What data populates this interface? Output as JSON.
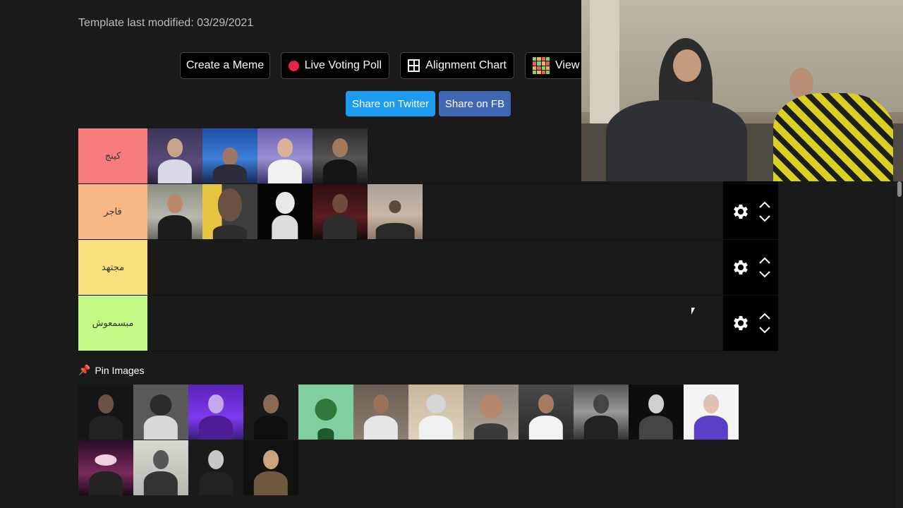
{
  "template_modified": "Template last modified: 03/29/2021",
  "toolbar": {
    "create_meme": "Create a Meme",
    "live_voting": "Live Voting Poll",
    "alignment_chart": "Alignment Chart",
    "view": "View"
  },
  "share": {
    "twitter": "Share on Twitter",
    "fb": "Share on FB"
  },
  "tiers": [
    {
      "label": "كينج",
      "color": "#f47c7c"
    },
    {
      "label": "فاجر",
      "color": "#f7b785"
    },
    {
      "label": "مجتهد",
      "color": "#f9df7c"
    },
    {
      "label": "مبسمعوش",
      "color": "#c3fa85"
    }
  ],
  "pin_images_label": "Pin Images",
  "icons": {
    "pin": "pushpin-icon",
    "gear": "gear-icon",
    "up": "chevron-up-icon",
    "down": "chevron-down-icon",
    "live": "red-dot-icon",
    "alignment": "grid-icon",
    "view": "mosaic-icon"
  },
  "colors": {
    "background": "#1a1a1b",
    "twitter": "#1d9bf0",
    "facebook": "#4267b2",
    "live_dot": "#e5254b"
  }
}
